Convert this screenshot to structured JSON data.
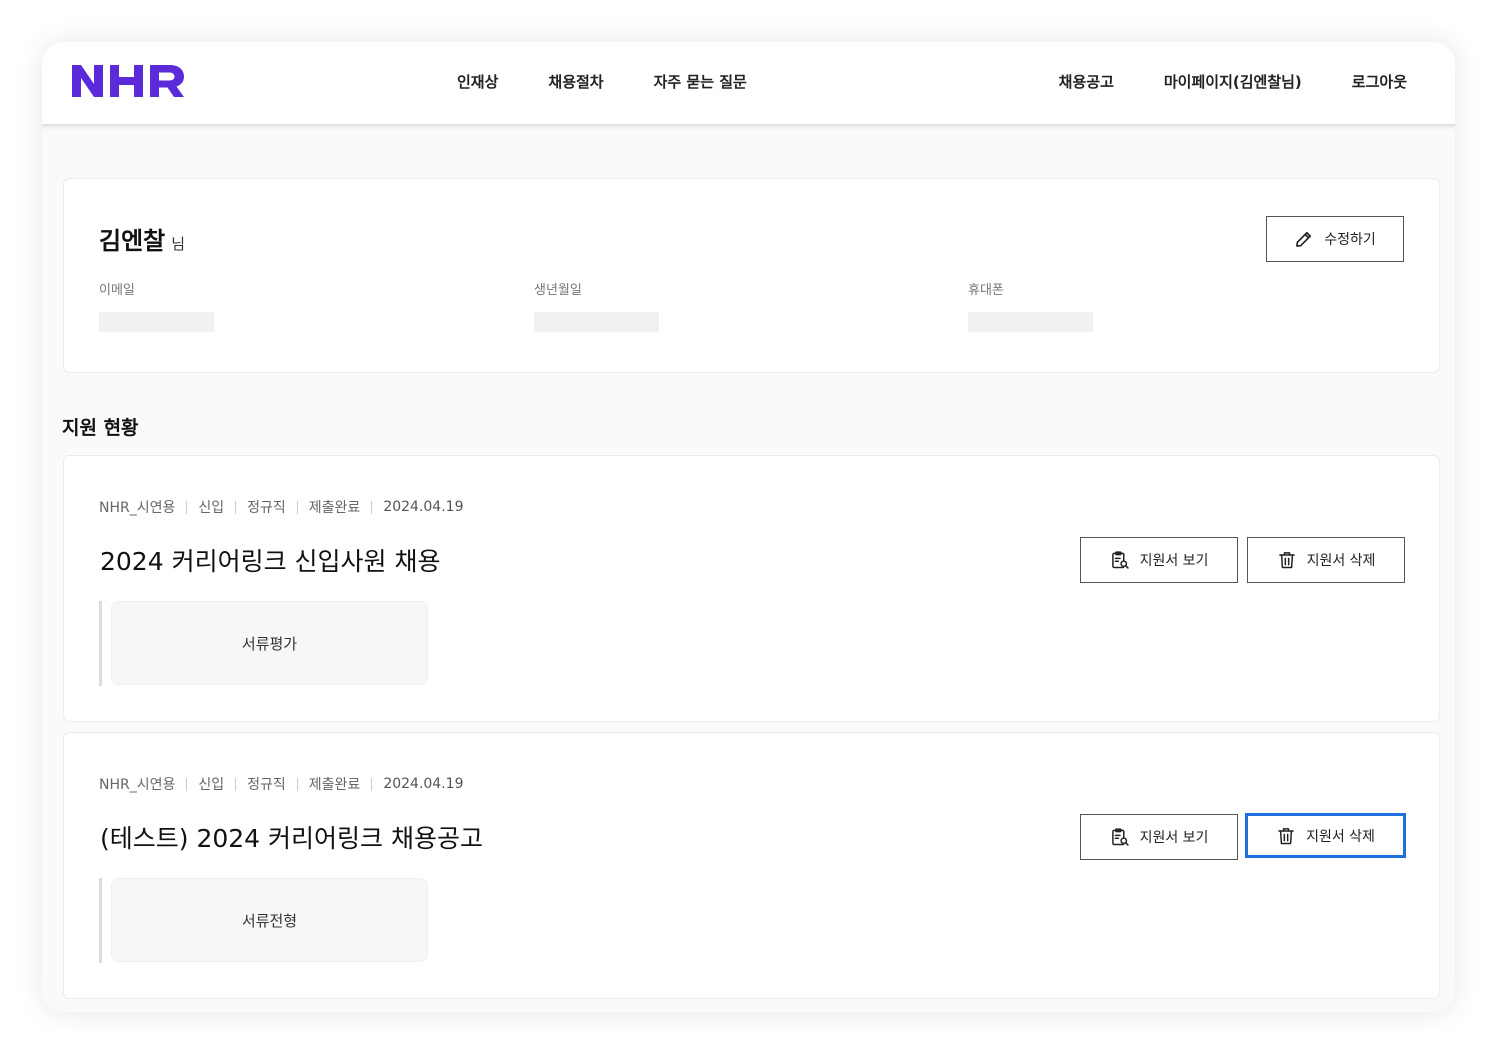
{
  "brand": {
    "logo_text": "NHR",
    "accent": "#5b2bd9"
  },
  "nav": {
    "left": [
      "인재상",
      "채용절차",
      "자주 묻는 질문"
    ],
    "right": [
      "채용공고",
      "마이페이지(김엔찰님)",
      "로그아웃"
    ]
  },
  "profile": {
    "name": "김엔찰",
    "suffix": "님",
    "edit_label": "수정하기",
    "fields": [
      {
        "label": "이메일",
        "value": ""
      },
      {
        "label": "생년월일",
        "value": ""
      },
      {
        "label": "휴대폰",
        "value": ""
      }
    ]
  },
  "applications_title": "지원 현황",
  "applications": [
    {
      "company": "NHR_시연용",
      "career": "신입",
      "employment": "정규직",
      "status": "제출완료",
      "date": "2024.04.19",
      "title": "2024 커리어링크 신입사원 채용",
      "stage": "서류평가",
      "view_label": "지원서 보기",
      "delete_label": "지원서 삭제"
    },
    {
      "company": "NHR_시연용",
      "career": "신입",
      "employment": "정규직",
      "status": "제출완료",
      "date": "2024.04.19",
      "title": "(테스트) 2024 커리어링크 채용공고",
      "stage": "서류전형",
      "view_label": "지원서 보기",
      "delete_label": "지원서 삭제"
    }
  ]
}
